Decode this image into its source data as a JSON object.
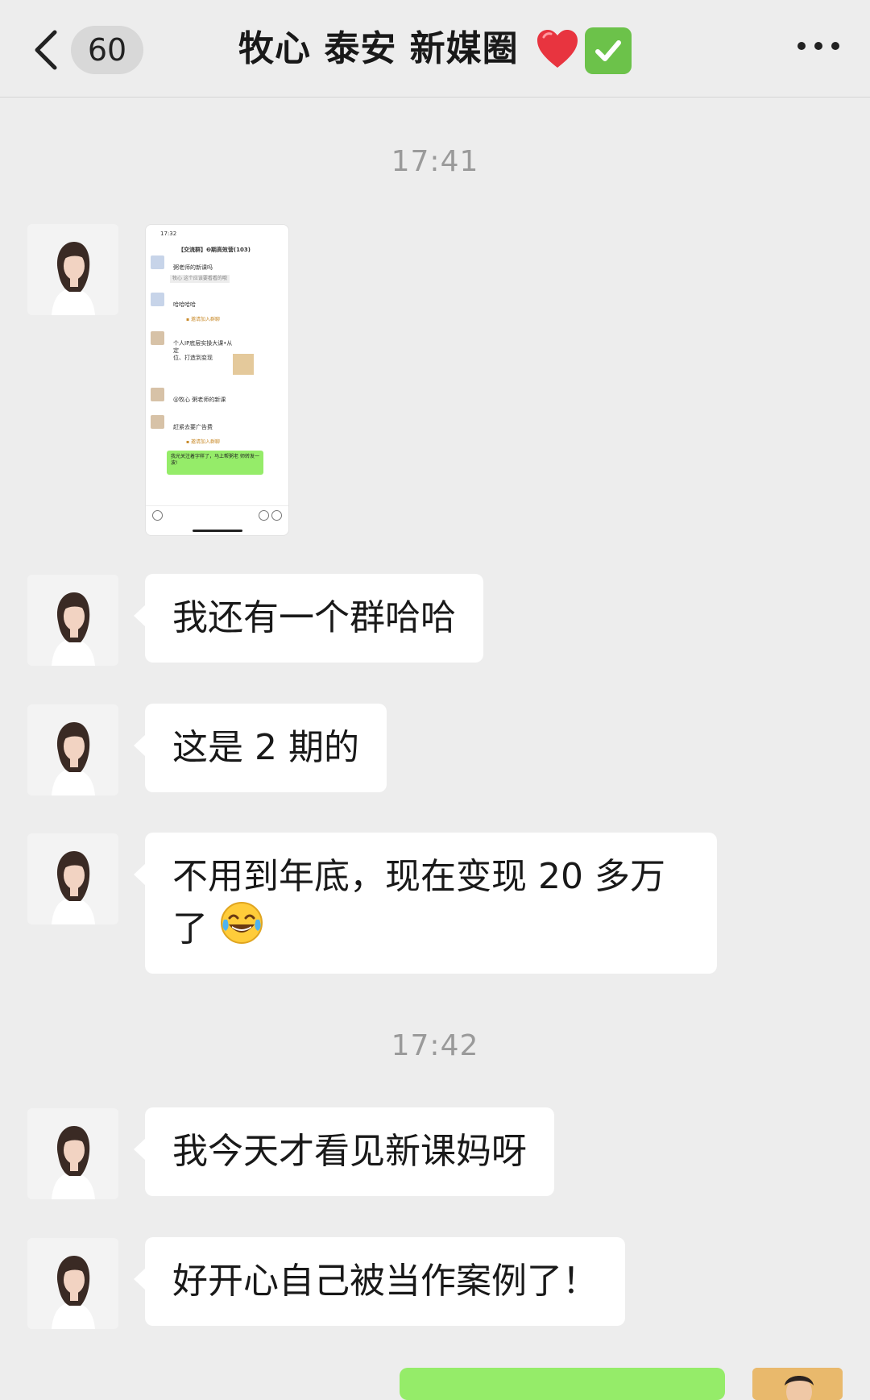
{
  "header": {
    "back_label": "<",
    "unread_count": "60",
    "title": "牧心 泰安 新媒圈",
    "title_icons": [
      "red-heart",
      "green-check-mark"
    ],
    "more_icon": "more-dots"
  },
  "timestamps": [
    "17:41",
    "17:42"
  ],
  "messages": [
    {
      "type": "image",
      "sender": "left"
    },
    {
      "type": "text",
      "sender": "left",
      "text": "我还有一个群哈哈"
    },
    {
      "type": "text",
      "sender": "left",
      "text": "这是 2 期的"
    },
    {
      "type": "text",
      "sender": "left",
      "line1": "不用到年底，现在变现 20 多万",
      "line2": "了"
    },
    {
      "type": "text",
      "sender": "left",
      "text": "我今天才看见新课妈呀"
    },
    {
      "type": "text",
      "sender": "left",
      "text": "好开心自己被当作案例了！"
    },
    {
      "type": "text",
      "sender": "right",
      "text": ""
    }
  ],
  "thumbnail": {
    "time": "17:32",
    "title": "【交流群】❷期高效营(103)",
    "lines": [
      "粥老师的新课吗",
      "牧心  这个应该要看看的哦",
      "哈哈哈哈",
      "个人IP底层实操大课•从定",
      "位、打造到变现",
      "@牧心 粥老师的新课",
      "赶紧去要广告费",
      "我光关注着字样了，马上帮粥老",
      "师转发一波!"
    ]
  },
  "colors": {
    "background": "#ededed",
    "bubble_white": "#ffffff",
    "bubble_green": "#95ec69",
    "timestamp": "#9a9a9a"
  }
}
